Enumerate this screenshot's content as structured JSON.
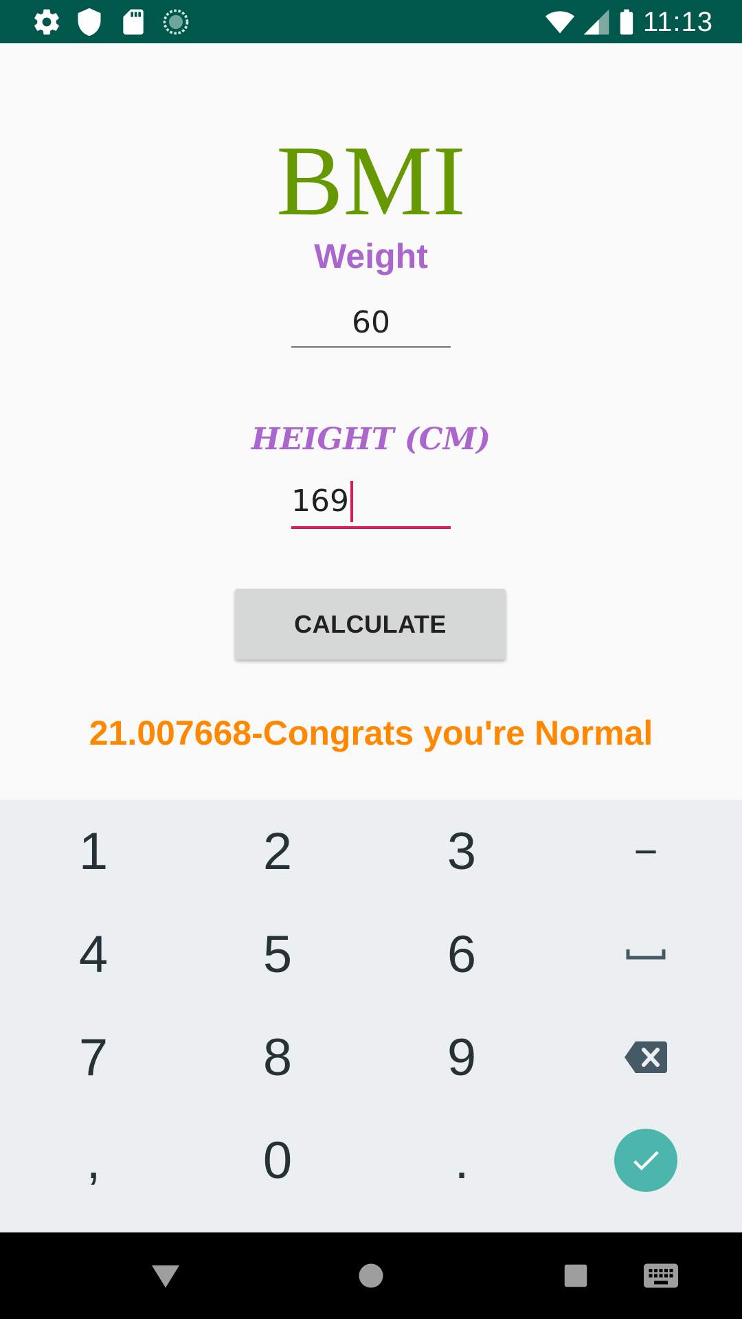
{
  "status_bar": {
    "time": "11:13",
    "left_icons": [
      "settings-icon",
      "shield-icon",
      "sd-card-icon",
      "sync-icon"
    ],
    "right_icons": [
      "wifi-icon",
      "signal-icon",
      "battery-icon"
    ],
    "background": "#00574b"
  },
  "app": {
    "title": "BMI",
    "weight_label": "Weight",
    "weight_value": "60",
    "height_label": "HEIGHT (CM)",
    "height_value": "169",
    "calculate_label": "CALCULATE",
    "result": "21.007668-Congrats you're Normal",
    "colors": {
      "title": "#669900",
      "labels": "#aa66cc",
      "result": "#ff8800",
      "accent": "#d81b60"
    }
  },
  "keyboard": {
    "rows": [
      [
        "1",
        "2",
        "3",
        "−"
      ],
      [
        "4",
        "5",
        "6",
        "space-icon"
      ],
      [
        "7",
        "8",
        "9",
        "backspace-icon"
      ],
      [
        ",",
        "0",
        ".",
        "done-check-icon"
      ]
    ],
    "done_color": "#4db6ac"
  },
  "nav_bar": {
    "buttons": [
      "back-icon",
      "home-icon",
      "recents-icon",
      "keyboard-switch-icon"
    ]
  }
}
